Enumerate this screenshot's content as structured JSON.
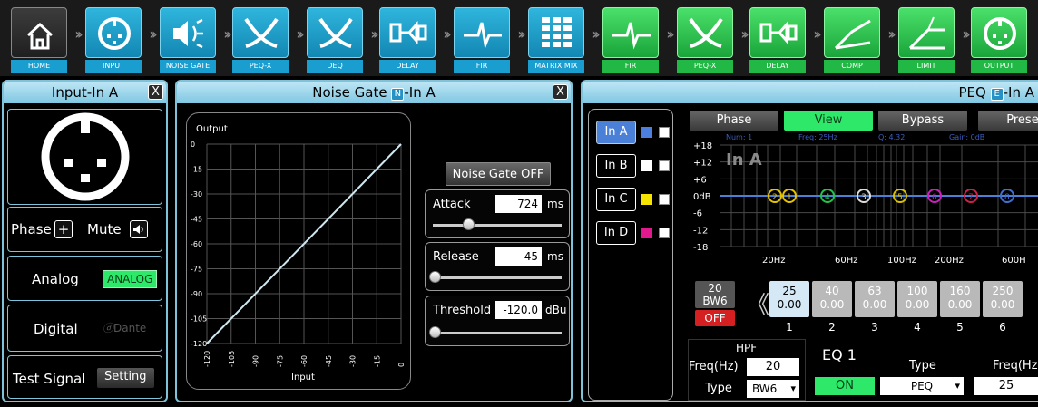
{
  "toolbar": {
    "items": [
      {
        "label": "HOME",
        "icon": "home-icon",
        "color": "home"
      },
      {
        "label": "INPUT",
        "icon": "input-jack-icon",
        "color": "blue"
      },
      {
        "label": "NOISE GATE",
        "icon": "speaker-icon",
        "color": "blue"
      },
      {
        "label": "PEQ-X",
        "icon": "crossover-icon",
        "color": "blue"
      },
      {
        "label": "DEQ",
        "icon": "crossover-icon",
        "color": "blue"
      },
      {
        "label": "DELAY",
        "icon": "delay-icon",
        "color": "blue"
      },
      {
        "label": "FIR",
        "icon": "fir-icon",
        "color": "blue"
      },
      {
        "label": "MATRIX MIX",
        "icon": "matrix-icon",
        "color": "blue"
      },
      {
        "label": "FIR",
        "icon": "fir-icon",
        "color": "green"
      },
      {
        "label": "PEQ-X",
        "icon": "crossover-icon",
        "color": "green"
      },
      {
        "label": "DELAY",
        "icon": "delay-icon",
        "color": "green"
      },
      {
        "label": "COMP",
        "icon": "compressor-icon",
        "color": "green"
      },
      {
        "label": "LIMIT",
        "icon": "limiter-icon",
        "color": "green"
      },
      {
        "label": "OUTPUT",
        "icon": "output-jack-icon",
        "color": "green"
      }
    ]
  },
  "input_panel": {
    "title": "Input-In A",
    "close": "X",
    "phase_label": "Phase",
    "phase_btn": "+",
    "mute_label": "Mute",
    "analog_label": "Analog",
    "analog_btn": "ANALOG",
    "digital_label": "Digital",
    "dante_btn": "Dante",
    "test_label": "Test Signal",
    "setting_btn": "Setting"
  },
  "gate_panel": {
    "title_pre": "Noise Gate",
    "title_badge": "N",
    "title_post": "-In A",
    "close": "X",
    "graph": {
      "ylabel": "Output",
      "xlabel": "Input",
      "y_ticks": [
        "0",
        "-15",
        "-30",
        "-45",
        "-60",
        "-75",
        "-90",
        "-105",
        "-120"
      ],
      "x_ticks": [
        "-120",
        "-105",
        "-90",
        "-75",
        "-60",
        "-45",
        "-30",
        "-15",
        "0"
      ]
    },
    "gate_button": "Noise Gate OFF",
    "attack": {
      "label": "Attack",
      "value": "724",
      "unit": "ms",
      "level": 0.27
    },
    "release": {
      "label": "Release",
      "value": "45",
      "unit": "ms",
      "level": 0.0
    },
    "threshold": {
      "label": "Threshold",
      "value": "-120.0",
      "unit": "dBu",
      "level": 0.0
    }
  },
  "peq_panel": {
    "title_pre": "PEQ",
    "title_badge": "E",
    "title_post": "-In A",
    "channels": [
      {
        "label": "In A",
        "color": "#4d7fe0",
        "active": true
      },
      {
        "label": "In B",
        "color": "#ffffff",
        "active": false
      },
      {
        "label": "In C",
        "color": "#f5e400",
        "active": false
      },
      {
        "label": "In D",
        "color": "#e0198e",
        "active": false
      }
    ],
    "tabs": [
      "Phase",
      "View",
      "Bypass",
      "Prese"
    ],
    "graph": {
      "status": [
        "Num: 1",
        "Freq: 25Hz",
        "Q: 4.32",
        "Gain: 0dB"
      ],
      "overlay": "In A",
      "y_ticks": [
        "+18",
        "+12",
        "+6",
        "0dB",
        "-6",
        "-12",
        "-18"
      ],
      "x_ticks": [
        "20Hz",
        "60Hz",
        "100Hz",
        "200Hz",
        "600H"
      ],
      "nodes": [
        {
          "n": "2",
          "color": "#e6c300"
        },
        {
          "n": "1",
          "color": "#e6c300"
        },
        {
          "n": "4",
          "color": "#22c44a"
        },
        {
          "n": "3",
          "color": "#dddddd"
        },
        {
          "n": "5",
          "color": "#d8c000"
        },
        {
          "n": "6",
          "color": "#d01ec0"
        },
        {
          "n": "7",
          "color": "#d0204a"
        },
        {
          "n": "8",
          "color": "#4070d0"
        }
      ]
    },
    "hpf_box": {
      "top": "20",
      "bottom": "BW6",
      "off": "OFF"
    },
    "bands": [
      {
        "freq": "25",
        "gain": "0.00",
        "num": "1",
        "active": true
      },
      {
        "freq": "40",
        "gain": "0.00",
        "num": "2",
        "active": false
      },
      {
        "freq": "63",
        "gain": "0.00",
        "num": "3",
        "active": false
      },
      {
        "freq": "100",
        "gain": "0.00",
        "num": "4",
        "active": false
      },
      {
        "freq": "160",
        "gain": "0.00",
        "num": "5",
        "active": false
      },
      {
        "freq": "250",
        "gain": "0.00",
        "num": "6",
        "active": false
      }
    ],
    "hpf": {
      "title": "HPF",
      "freq_label": "Freq(Hz)",
      "freq": "20",
      "type_label": "Type",
      "type": "BW6"
    },
    "eq": {
      "title": "EQ 1",
      "on_btn": "ON",
      "type_label": "Type",
      "type": "PEQ",
      "freq_label": "Freq(Hz",
      "freq": "25"
    }
  }
}
